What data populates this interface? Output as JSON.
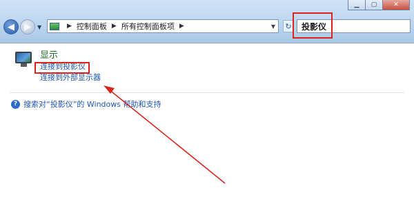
{
  "address_bar": {
    "segments": [
      "控制面板",
      "所有控制面板项"
    ]
  },
  "search": {
    "value": "投影仪"
  },
  "results": {
    "title": "显示",
    "links": [
      "连接到投影仪",
      "连接到外部显示器"
    ]
  },
  "help": {
    "text": "搜索对“投影仪”的 Windows 帮助和支持"
  },
  "colors": {
    "highlight": "#d8241c",
    "link": "#1f55b5",
    "result_title": "#1d6a22"
  },
  "icons": [
    "back-icon",
    "forward-icon",
    "control-panel-icon",
    "refresh-icon",
    "monitor-icon",
    "help-icon"
  ]
}
